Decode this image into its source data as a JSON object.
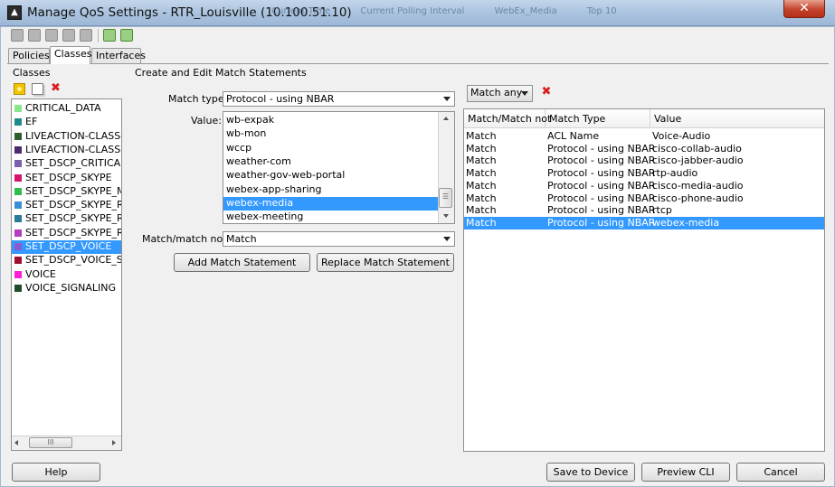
{
  "window": {
    "title": "Manage QoS Settings - RTR_Louisville (10.100.51.10)",
    "background_tabs": [
      "Current Time",
      "Current Polling Interval",
      "WebEx_Media",
      "Top 10"
    ],
    "close_glyph": "✕"
  },
  "tabs": [
    {
      "label": "Policies"
    },
    {
      "label": "Classes"
    },
    {
      "label": "Interfaces"
    }
  ],
  "classes_panel": {
    "heading": "Classes",
    "items": [
      {
        "label": "CRITICAL_DATA",
        "color": "#88e888"
      },
      {
        "label": "EF",
        "color": "#1f8c8c"
      },
      {
        "label": "LIVEACTION-CLASS-A",
        "color": "#2e5e2e"
      },
      {
        "label": "LIVEACTION-CLASS-M",
        "color": "#4b2a6e"
      },
      {
        "label": "SET_DSCP_CRITICAL_",
        "color": "#7b5fb0"
      },
      {
        "label": "SET_DSCP_SKYPE",
        "color": "#d6156f"
      },
      {
        "label": "SET_DSCP_SKYPE_MS",
        "color": "#2cbd4a"
      },
      {
        "label": "SET_DSCP_SKYPE_RT",
        "color": "#3a8fd8"
      },
      {
        "label": "SET_DSCP_SKYPE_RT",
        "color": "#2a7a9a"
      },
      {
        "label": "SET_DSCP_SKYPE_RT",
        "color": "#b33cc0"
      },
      {
        "label": "SET_DSCP_VOICE",
        "color": "#8a5ad0"
      },
      {
        "label": "SET_DSCP_VOICE_SIG",
        "color": "#9e1030"
      },
      {
        "label": "VOICE",
        "color": "#ff1dd9"
      },
      {
        "label": "VOICE_SIGNALING",
        "color": "#1f4d26"
      }
    ],
    "selected_index": 10,
    "hscroll_thumb": "III"
  },
  "edit_panel": {
    "heading": "Create and Edit Match Statements",
    "match_type_label": "Match type:",
    "match_type_value": "Protocol - using NBAR",
    "value_label": "Value:",
    "value_options": [
      "wb-expak",
      "wb-mon",
      "wccp",
      "weather-com",
      "weather-gov-web-portal",
      "webex-app-sharing",
      "webex-media",
      "webex-meeting"
    ],
    "selected_value": "webex-media",
    "match_not_label": "Match/match not:",
    "match_not_value": "Match",
    "add_button": "Add Match Statement",
    "replace_button": "Replace Match Statement",
    "vscroll_thumb": "☰"
  },
  "match_panel": {
    "match_any_value": "Match any",
    "columns": [
      "Match/Match not",
      "Match Type",
      "Value"
    ],
    "rows": [
      [
        "Match",
        "ACL Name",
        "Voice-Audio"
      ],
      [
        "Match",
        "Protocol - using NBAR",
        "cisco-collab-audio"
      ],
      [
        "Match",
        "Protocol - using NBAR",
        "cisco-jabber-audio"
      ],
      [
        "Match",
        "Protocol - using NBAR",
        "rtp-audio"
      ],
      [
        "Match",
        "Protocol - using NBAR",
        "cisco-media-audio"
      ],
      [
        "Match",
        "Protocol - using NBAR",
        "cisco-phone-audio"
      ],
      [
        "Match",
        "Protocol - using NBAR",
        "rtcp"
      ],
      [
        "Match",
        "Protocol - using NBAR",
        "webex-media"
      ]
    ],
    "selected_row": 7
  },
  "footer": {
    "help": "Help",
    "save": "Save to Device",
    "preview": "Preview CLI",
    "cancel": "Cancel"
  },
  "colors": {
    "selection": "#3399ff",
    "add_icon": "#f2c300",
    "delete_icon": "#d82020"
  }
}
